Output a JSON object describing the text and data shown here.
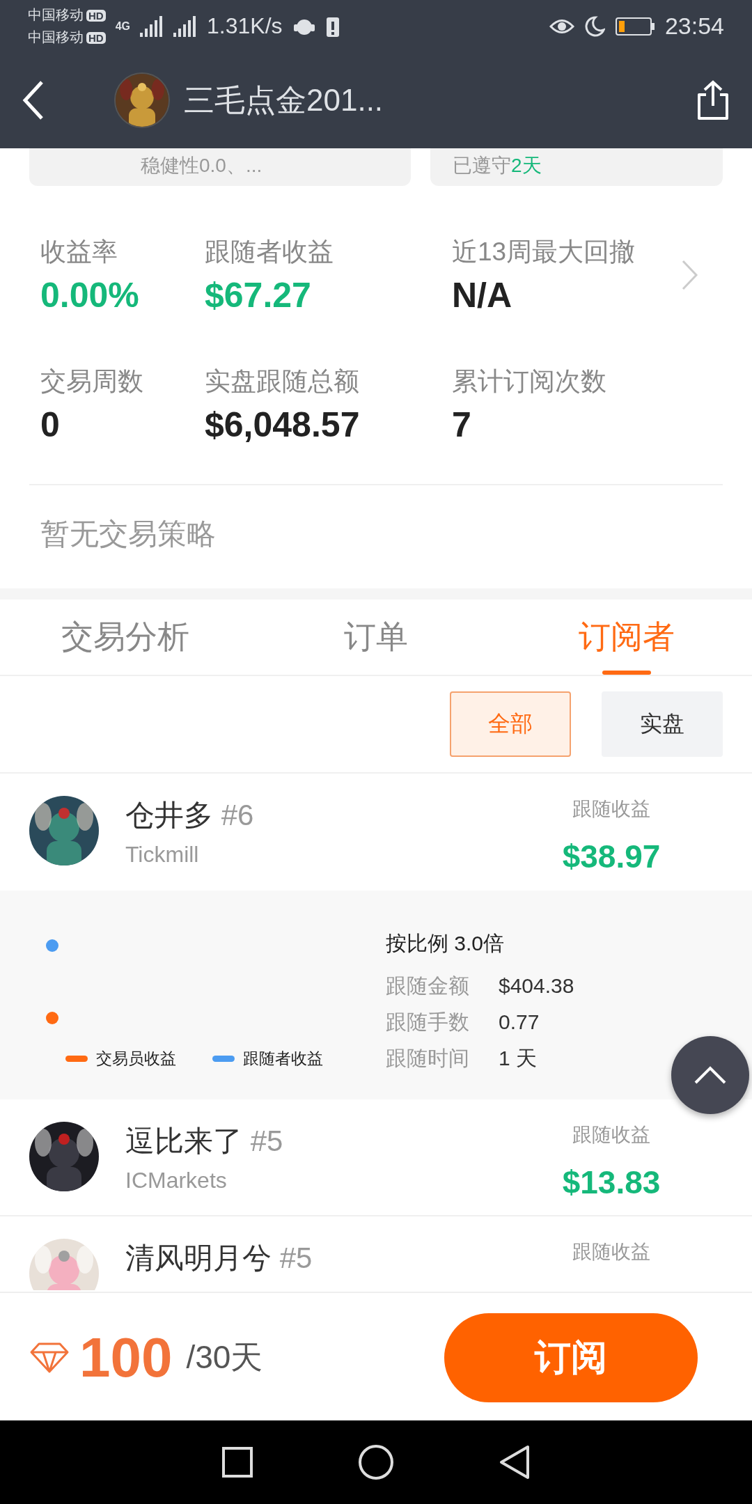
{
  "status_bar": {
    "carriers": [
      {
        "name": "中国移动",
        "badge": "HD"
      },
      {
        "name": "中国移动",
        "badge": "HD"
      }
    ],
    "network": "4G",
    "speed": "1.31K/s",
    "time": "23:54"
  },
  "header": {
    "title": "三毛点金201..."
  },
  "cards": [
    {
      "text": "稳健性0.0、..."
    },
    {
      "text": "已遵守",
      "highlight": "2天"
    }
  ],
  "stats": [
    {
      "label": "收益率",
      "value": "0.00%",
      "kind": "positive"
    },
    {
      "label": "跟随者收益",
      "value": "$67.27",
      "kind": "positive"
    },
    {
      "label": "近13周最大回撤",
      "value": "N/A",
      "kind": "neutral"
    },
    {
      "label": "交易周数",
      "value": "0",
      "kind": "neutral"
    },
    {
      "label": "实盘跟随总额",
      "value": "$6,048.57",
      "kind": "neutral"
    },
    {
      "label": "累计订阅次数",
      "value": "7",
      "kind": "neutral"
    }
  ],
  "strategy_note": "暂无交易策略",
  "tabs": [
    {
      "label": "交易分析",
      "selected": false
    },
    {
      "label": "订单",
      "selected": false
    },
    {
      "label": "订阅者",
      "selected": true
    }
  ],
  "filters": [
    {
      "label": "全部",
      "selected": true
    },
    {
      "label": "实盘",
      "selected": false
    }
  ],
  "subscribers": [
    {
      "name": "仓井多",
      "rank": "#6",
      "broker": "Tickmill",
      "earnings_label": "跟随收益",
      "earnings": "$38.97",
      "expanded": true
    },
    {
      "name": "逗比来了",
      "rank": "#5",
      "broker": "ICMarkets",
      "earnings_label": "跟随收益",
      "earnings": "$13.83",
      "expanded": false
    },
    {
      "name": "清风明月兮",
      "rank": "#5",
      "earnings_label": "跟随收益"
    }
  ],
  "detail": {
    "legend": [
      {
        "label": "交易员收益",
        "color": "#ff6a13"
      },
      {
        "label": "跟随者收益",
        "color": "#4c9cf1"
      }
    ],
    "ratio": "按比例 3.0倍",
    "rows": [
      {
        "label": "跟随金额",
        "value": "$404.38"
      },
      {
        "label": "跟随手数",
        "value": "0.77"
      },
      {
        "label": "跟随时间",
        "value": "1 天"
      }
    ]
  },
  "bottom_bar": {
    "price": "100",
    "period": "/30天",
    "subscribe": "订阅"
  }
}
